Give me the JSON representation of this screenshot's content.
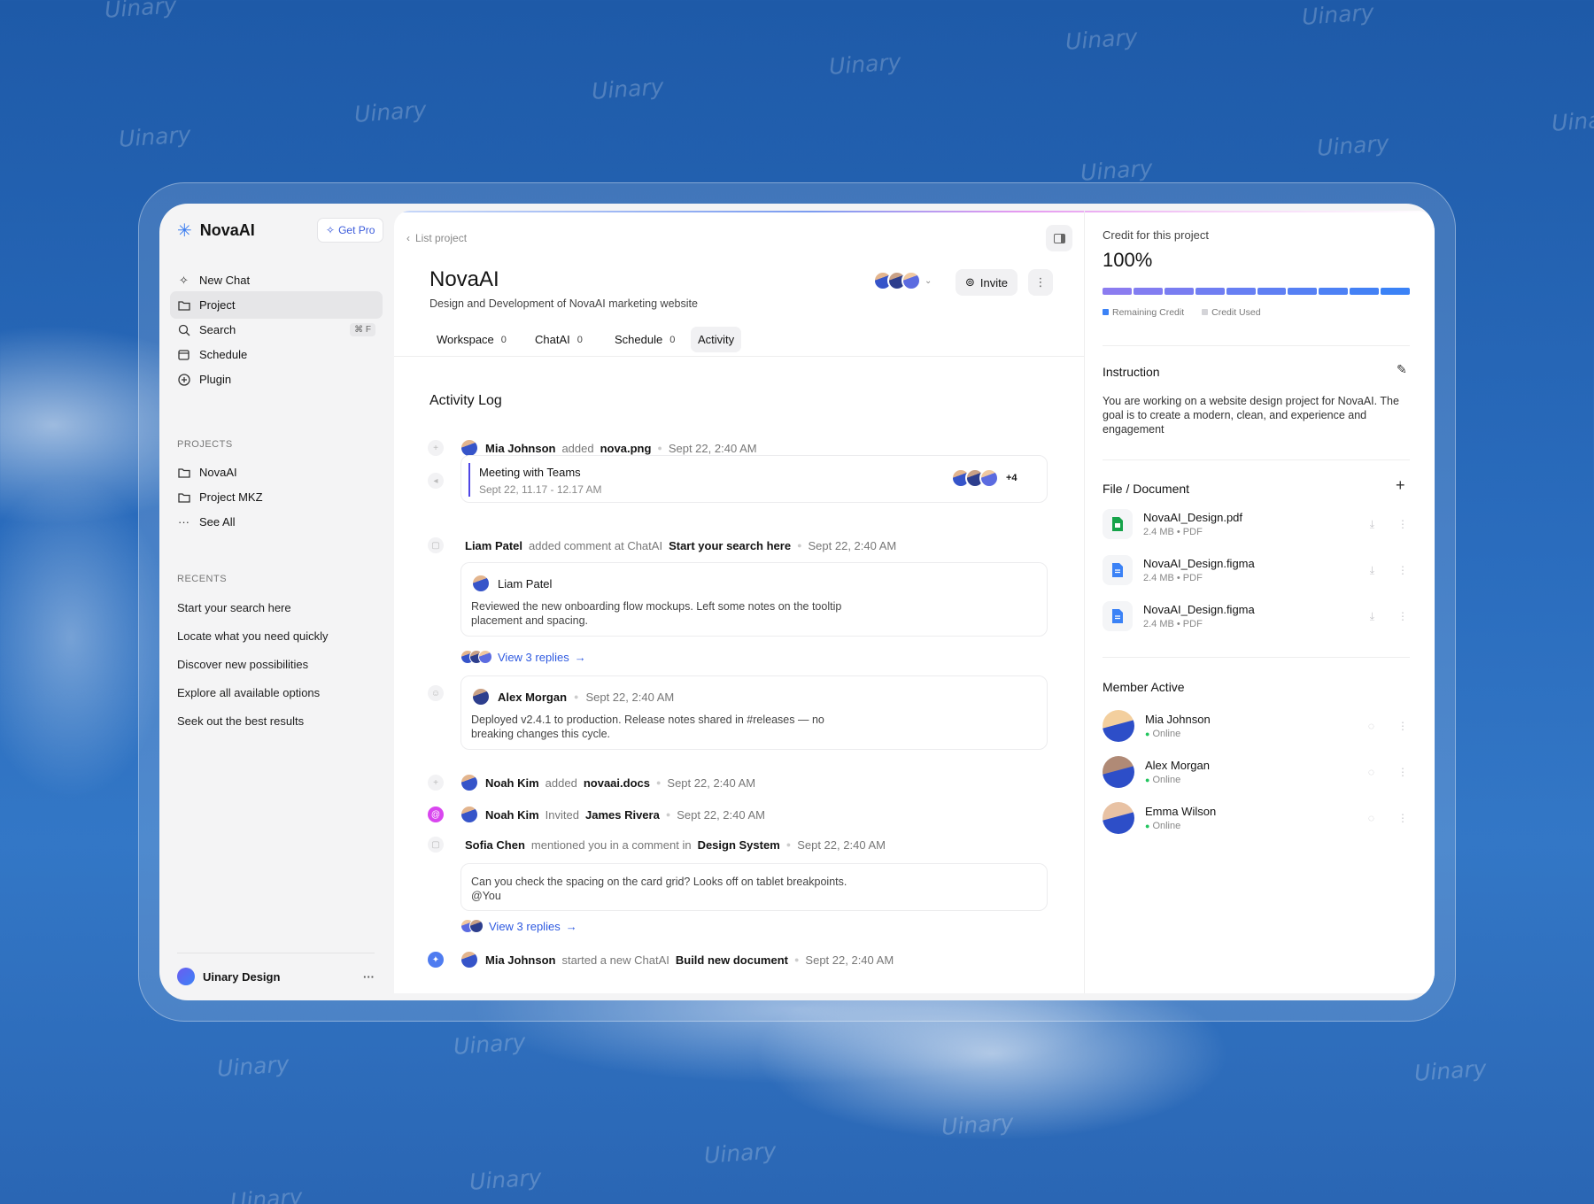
{
  "watermark": "Uinary",
  "app": {
    "name": "NovaAI",
    "get_pro": "Get Pro"
  },
  "sidebar": {
    "nav": [
      {
        "label": "New Chat",
        "icon": "sparkle-icon"
      },
      {
        "label": "Project",
        "icon": "folder-icon",
        "active": true
      },
      {
        "label": "Search",
        "icon": "search-icon",
        "shortcut": "⌘ F"
      },
      {
        "label": "Schedule",
        "icon": "calendar-icon"
      },
      {
        "label": "Plugin",
        "icon": "plus-circle-icon"
      }
    ],
    "projects_heading": "PROJECTS",
    "projects": [
      {
        "label": "NovaAI"
      },
      {
        "label": "Project MKZ"
      },
      {
        "label": "See All"
      }
    ],
    "recents_heading": "RECENTS",
    "recents": [
      "Start your search here",
      "Locate what you need quickly",
      "Discover new possibilities",
      "Explore all available options",
      "Seek out the best results"
    ],
    "workspace": "Uinary Design",
    "workspace_more": "···"
  },
  "header": {
    "back": "List project",
    "title": "NovaAI",
    "subtitle": "Design and Development of NovaAI marketing website",
    "invite": "Invite"
  },
  "tabs": [
    {
      "label": "Workspace",
      "count": "0"
    },
    {
      "label": "ChatAI",
      "count": "0"
    },
    {
      "label": "Schedule",
      "count": "0"
    },
    {
      "label": "Activity",
      "active": true
    }
  ],
  "activity": {
    "heading": "Activity Log",
    "a1": {
      "name": "Mia Johnson",
      "action": "added",
      "object": "nova.png",
      "time": "Sept 22, 2:40 AM"
    },
    "meeting": {
      "title": "Meeting with Teams",
      "time": "Sept 22, 11.17 - 12.17 AM",
      "extra": "+4"
    },
    "a2": {
      "name": "Liam Patel",
      "action": "added comment at ChatAI",
      "object": "Start your search here",
      "time": "Sept 22, 2:40 AM",
      "card_name": "Liam Patel",
      "card_text": "Reviewed the new onboarding flow mockups. Left some notes on the tooltip placement and spacing.",
      "replies": "View 3 replies"
    },
    "a3": {
      "name": "Alex Morgan",
      "time": "Sept 22, 2:40 AM",
      "text": "Deployed v2.4.1 to production. Release notes shared in #releases — no breaking changes this cycle."
    },
    "a4": {
      "name": "Noah Kim",
      "action": "added",
      "object": "novaai.docs",
      "time": "Sept 22, 2:40 AM"
    },
    "a5": {
      "name": "Noah Kim",
      "action": "Invited",
      "object": "James Rivera",
      "time": "Sept 22, 2:40 AM"
    },
    "a6": {
      "name": "Sofia Chen",
      "action": "mentioned you in a comment in",
      "object": "Design System",
      "time": "Sept 22, 2:40 AM",
      "text": "Can you check the spacing on the card grid? Looks off on tablet breakpoints. @You",
      "replies": "View 3 replies"
    },
    "a7": {
      "name": "Mia Johnson",
      "action": "started a new ChatAI",
      "object": "Build new document",
      "time": "Sept 22, 2:40 AM"
    }
  },
  "credit": {
    "label": "Credit for this project",
    "value": "100%",
    "progress": 1.0,
    "segments": 10,
    "legend_remaining": "Remaining Credit",
    "legend_used": "Credit Used"
  },
  "instruction": {
    "heading": "Instruction",
    "text": "You are working on a website design project for NovaAI. The goal is to create a modern, clean, and experience and engagement"
  },
  "files": {
    "heading": "File / Document",
    "items": [
      {
        "name": "NovaAI_Design.pdf",
        "meta": "2.4 MB • PDF",
        "icon": "sheet-icon"
      },
      {
        "name": "NovaAI_Design.figma",
        "meta": "2.4 MB • PDF",
        "icon": "doc-icon"
      },
      {
        "name": "NovaAI_Design.figma",
        "meta": "2.4 MB • PDF",
        "icon": "doc-icon"
      }
    ]
  },
  "members": {
    "heading": "Member Active",
    "items": [
      {
        "name": "Mia Johnson",
        "status": "Online"
      },
      {
        "name": "Alex Morgan",
        "status": "Online"
      },
      {
        "name": "Emma Wilson",
        "status": "Online"
      }
    ]
  },
  "colors": {
    "accent": "#2f5ae0",
    "online": "#22c55e",
    "bar_start": "#8b7cf0",
    "bar_end": "#3b82f6"
  }
}
